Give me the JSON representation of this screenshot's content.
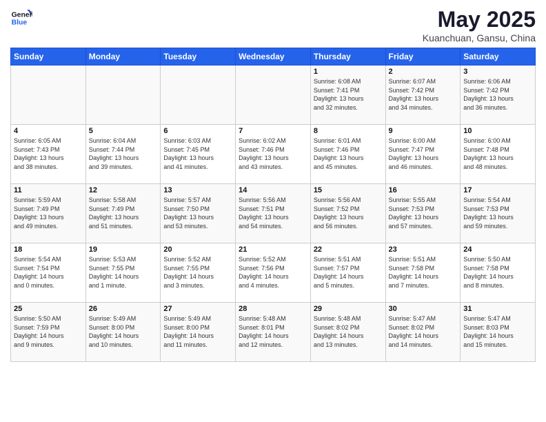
{
  "header": {
    "logo_line1": "General",
    "logo_line2": "Blue",
    "title": "May 2025",
    "subtitle": "Kuanchuan, Gansu, China"
  },
  "columns": [
    "Sunday",
    "Monday",
    "Tuesday",
    "Wednesday",
    "Thursday",
    "Friday",
    "Saturday"
  ],
  "weeks": [
    [
      {
        "day": "",
        "info": "",
        "empty": true
      },
      {
        "day": "",
        "info": "",
        "empty": true
      },
      {
        "day": "",
        "info": "",
        "empty": true
      },
      {
        "day": "",
        "info": "",
        "empty": true
      },
      {
        "day": "1",
        "info": "Sunrise: 6:08 AM\nSunset: 7:41 PM\nDaylight: 13 hours\nand 32 minutes."
      },
      {
        "day": "2",
        "info": "Sunrise: 6:07 AM\nSunset: 7:42 PM\nDaylight: 13 hours\nand 34 minutes."
      },
      {
        "day": "3",
        "info": "Sunrise: 6:06 AM\nSunset: 7:42 PM\nDaylight: 13 hours\nand 36 minutes."
      }
    ],
    [
      {
        "day": "4",
        "info": "Sunrise: 6:05 AM\nSunset: 7:43 PM\nDaylight: 13 hours\nand 38 minutes."
      },
      {
        "day": "5",
        "info": "Sunrise: 6:04 AM\nSunset: 7:44 PM\nDaylight: 13 hours\nand 39 minutes."
      },
      {
        "day": "6",
        "info": "Sunrise: 6:03 AM\nSunset: 7:45 PM\nDaylight: 13 hours\nand 41 minutes."
      },
      {
        "day": "7",
        "info": "Sunrise: 6:02 AM\nSunset: 7:46 PM\nDaylight: 13 hours\nand 43 minutes."
      },
      {
        "day": "8",
        "info": "Sunrise: 6:01 AM\nSunset: 7:46 PM\nDaylight: 13 hours\nand 45 minutes."
      },
      {
        "day": "9",
        "info": "Sunrise: 6:00 AM\nSunset: 7:47 PM\nDaylight: 13 hours\nand 46 minutes."
      },
      {
        "day": "10",
        "info": "Sunrise: 6:00 AM\nSunset: 7:48 PM\nDaylight: 13 hours\nand 48 minutes."
      }
    ],
    [
      {
        "day": "11",
        "info": "Sunrise: 5:59 AM\nSunset: 7:49 PM\nDaylight: 13 hours\nand 49 minutes."
      },
      {
        "day": "12",
        "info": "Sunrise: 5:58 AM\nSunset: 7:49 PM\nDaylight: 13 hours\nand 51 minutes."
      },
      {
        "day": "13",
        "info": "Sunrise: 5:57 AM\nSunset: 7:50 PM\nDaylight: 13 hours\nand 53 minutes."
      },
      {
        "day": "14",
        "info": "Sunrise: 5:56 AM\nSunset: 7:51 PM\nDaylight: 13 hours\nand 54 minutes."
      },
      {
        "day": "15",
        "info": "Sunrise: 5:56 AM\nSunset: 7:52 PM\nDaylight: 13 hours\nand 56 minutes."
      },
      {
        "day": "16",
        "info": "Sunrise: 5:55 AM\nSunset: 7:53 PM\nDaylight: 13 hours\nand 57 minutes."
      },
      {
        "day": "17",
        "info": "Sunrise: 5:54 AM\nSunset: 7:53 PM\nDaylight: 13 hours\nand 59 minutes."
      }
    ],
    [
      {
        "day": "18",
        "info": "Sunrise: 5:54 AM\nSunset: 7:54 PM\nDaylight: 14 hours\nand 0 minutes."
      },
      {
        "day": "19",
        "info": "Sunrise: 5:53 AM\nSunset: 7:55 PM\nDaylight: 14 hours\nand 1 minute."
      },
      {
        "day": "20",
        "info": "Sunrise: 5:52 AM\nSunset: 7:55 PM\nDaylight: 14 hours\nand 3 minutes."
      },
      {
        "day": "21",
        "info": "Sunrise: 5:52 AM\nSunset: 7:56 PM\nDaylight: 14 hours\nand 4 minutes."
      },
      {
        "day": "22",
        "info": "Sunrise: 5:51 AM\nSunset: 7:57 PM\nDaylight: 14 hours\nand 5 minutes."
      },
      {
        "day": "23",
        "info": "Sunrise: 5:51 AM\nSunset: 7:58 PM\nDaylight: 14 hours\nand 7 minutes."
      },
      {
        "day": "24",
        "info": "Sunrise: 5:50 AM\nSunset: 7:58 PM\nDaylight: 14 hours\nand 8 minutes."
      }
    ],
    [
      {
        "day": "25",
        "info": "Sunrise: 5:50 AM\nSunset: 7:59 PM\nDaylight: 14 hours\nand 9 minutes."
      },
      {
        "day": "26",
        "info": "Sunrise: 5:49 AM\nSunset: 8:00 PM\nDaylight: 14 hours\nand 10 minutes."
      },
      {
        "day": "27",
        "info": "Sunrise: 5:49 AM\nSunset: 8:00 PM\nDaylight: 14 hours\nand 11 minutes."
      },
      {
        "day": "28",
        "info": "Sunrise: 5:48 AM\nSunset: 8:01 PM\nDaylight: 14 hours\nand 12 minutes."
      },
      {
        "day": "29",
        "info": "Sunrise: 5:48 AM\nSunset: 8:02 PM\nDaylight: 14 hours\nand 13 minutes."
      },
      {
        "day": "30",
        "info": "Sunrise: 5:47 AM\nSunset: 8:02 PM\nDaylight: 14 hours\nand 14 minutes."
      },
      {
        "day": "31",
        "info": "Sunrise: 5:47 AM\nSunset: 8:03 PM\nDaylight: 14 hours\nand 15 minutes."
      }
    ]
  ]
}
